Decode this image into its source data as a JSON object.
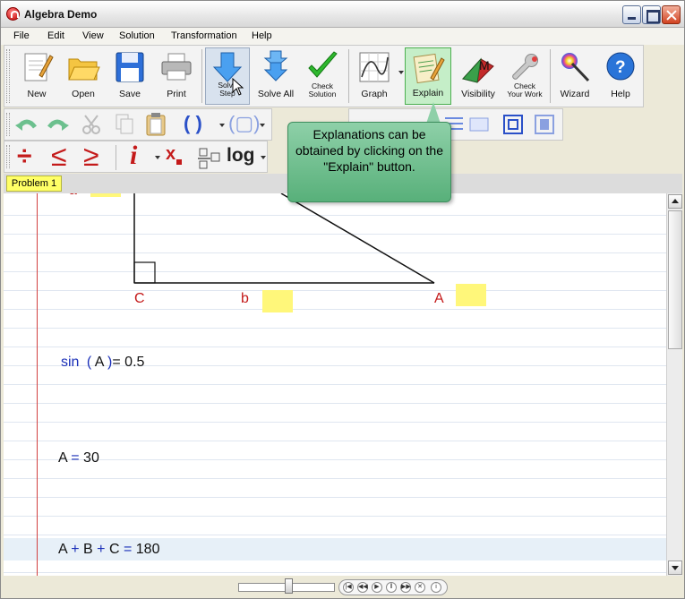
{
  "window": {
    "title": "Algebra Demo"
  },
  "menu": [
    "File",
    "Edit",
    "View",
    "Solution",
    "Transformation",
    "Help"
  ],
  "toolbar": {
    "new": "New",
    "open": "Open",
    "save": "Save",
    "print": "Print",
    "solve_step_1": "Solve",
    "solve_step_2": "Step",
    "solve_all": "Solve All",
    "check_solution_1": "Check",
    "check_solution_2": "Solution",
    "graph": "Graph",
    "explain": "Explain",
    "visibility": "Visibility",
    "check_work_1": "Check",
    "check_work_2": "Your Work",
    "wizard": "Wizard",
    "help": "Help",
    "visibility_glyph": "M",
    "help_glyph": "?"
  },
  "toolbar2": {
    "paren_open": "(",
    "paren_close": ")"
  },
  "toolbar3": {
    "divide": "÷",
    "le": "≤",
    "ge": "≥",
    "info": "i",
    "xsub": "x",
    "log": "log"
  },
  "tabs": [
    "Problem 1"
  ],
  "tooltip": "Explanations can be obtained by clicking on the \"Explain\" button.",
  "triangle": {
    "vertex_c": "C",
    "side_b": "b",
    "vertex_a": "A",
    "side_a": "a"
  },
  "equations": {
    "eq1": {
      "fn": "sin",
      "lp": "(",
      "arg": "A",
      "rp": ")",
      "rest": "= 0.5"
    },
    "eq2": {
      "lhs": "A",
      "op": "=",
      "rhs": "30"
    },
    "eq3": {
      "a": "A",
      "p1": "+",
      "b": "B",
      "p2": "+",
      "c": "C",
      "eq": "=",
      "rhs": "180"
    }
  },
  "colors": {
    "accent_red": "#c41a1a",
    "op_blue": "#1a2fb8",
    "highlight_yellow": "#fff77a",
    "tooltip_green": "#6cc08e"
  }
}
